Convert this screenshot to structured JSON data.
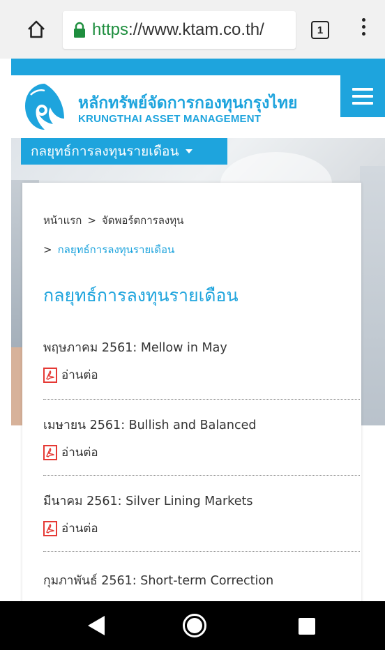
{
  "browser": {
    "url_scheme": "https",
    "url_rest": "://www.ktam.co.th/",
    "tab_count": "1"
  },
  "site": {
    "name_th": "หลักทรัพย์จัดการกองทุนกรุงไทย",
    "name_en": "KRUNGTHAI ASSET MANAGEMENT"
  },
  "strategy_menu": {
    "label": "กลยุทธ์การลงทุนรายเดือน"
  },
  "breadcrumb": {
    "home": "หน้าแรก",
    "portfolio": "จัดพอร์ตการลงทุน",
    "current": "กลยุทธ์การลงทุนรายเดือน",
    "separator": ">"
  },
  "page_title": "กลยุทธ์การลงทุนรายเดือน",
  "entries": [
    {
      "title": "พฤษภาคม 2561: Mellow in May",
      "read_label": "อ่านต่อ"
    },
    {
      "title": "เมษายน 2561: Bullish and Balanced",
      "read_label": "อ่านต่อ"
    },
    {
      "title": "มีนาคม 2561: Silver Lining Markets",
      "read_label": "อ่านต่อ"
    },
    {
      "title": "กุมภาพันธ์ 2561: Short-term Correction",
      "read_label": ""
    }
  ],
  "colors": {
    "brand": "#1ea4dd",
    "pdf_icon": "#e53935"
  },
  "icons": {
    "home": "home-icon",
    "lock": "lock-icon",
    "tabs": "tabs-icon",
    "menu": "more-vert-icon",
    "hamburger": "hamburger-icon",
    "pdf": "pdf-icon",
    "back": "back-icon",
    "home_nav": "home-nav-icon",
    "recents": "recents-icon"
  }
}
